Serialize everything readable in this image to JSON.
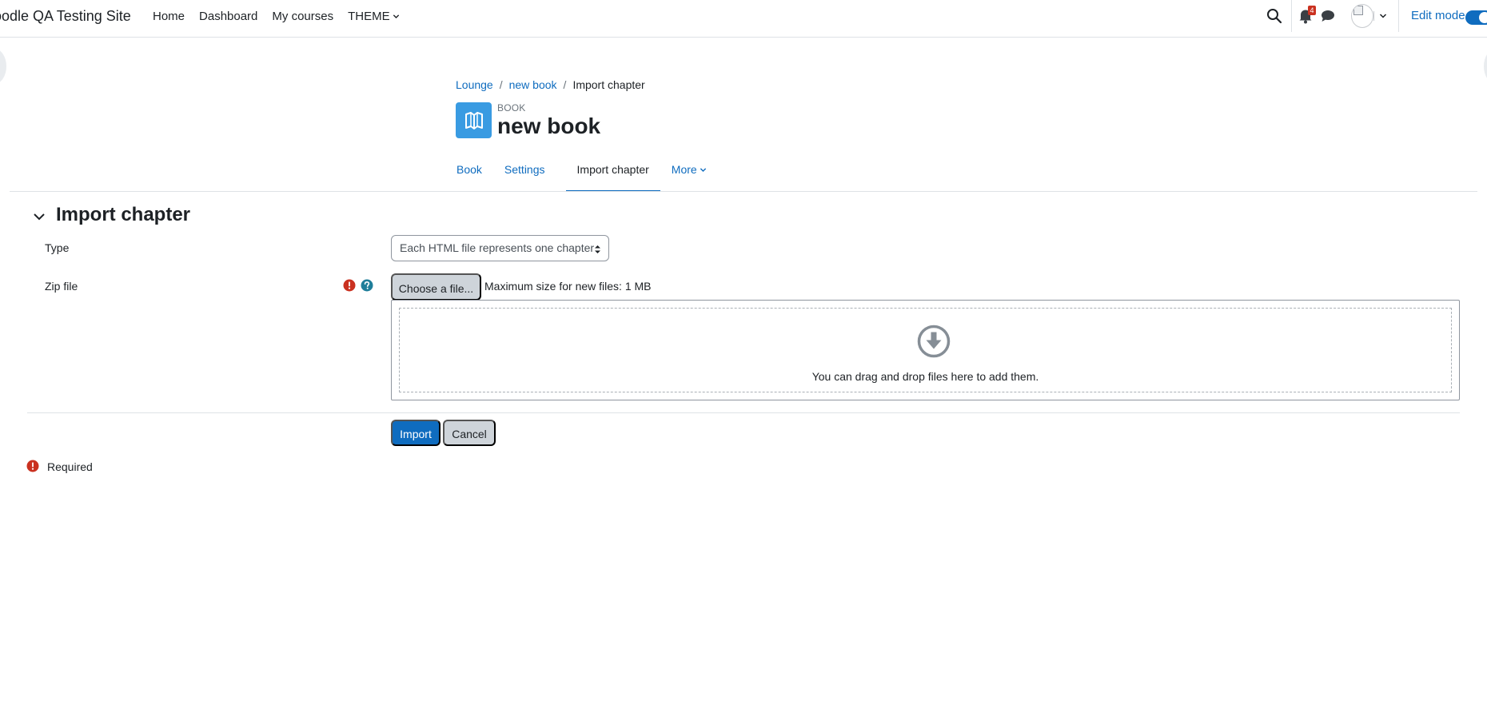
{
  "site": {
    "name": "oodle QA Testing Site"
  },
  "primary_nav": [
    {
      "label": "Home"
    },
    {
      "label": "Dashboard"
    },
    {
      "label": "My courses"
    },
    {
      "label": "THEME"
    }
  ],
  "user_menu": {
    "notification_count": "4",
    "edit_mode_label": "Edit mode",
    "edit_mode_on": true
  },
  "breadcrumb": [
    {
      "label": "Lounge"
    },
    {
      "label": "new book"
    },
    {
      "label": "Import chapter"
    }
  ],
  "header": {
    "activity_type": "BOOK",
    "title": "new book"
  },
  "secondary_nav": [
    {
      "label": "Book"
    },
    {
      "label": "Settings"
    },
    {
      "label": "Import chapter",
      "active": true
    },
    {
      "label": "More"
    }
  ],
  "form": {
    "section_title": "Import chapter",
    "type_label": "Type",
    "type_value": "Each HTML file represents one chapter",
    "zip_label": "Zip file",
    "choose_file_label": "Choose a file...",
    "max_size_text": "Maximum size for new files: 1 MB",
    "drop_text": "You can drag and drop files here to add them.",
    "import_label": "Import",
    "cancel_label": "Cancel",
    "required_text": "Required"
  },
  "colors": {
    "brand": "#0f6cbf",
    "activity_icon_bg": "#399be2",
    "danger": "#ca3120",
    "info": "#1f7e9a"
  },
  "icons": [
    "search-icon",
    "bell-icon",
    "chat-icon",
    "chevron-down-icon",
    "book-icon",
    "required-icon",
    "help-icon",
    "download-arrow-icon"
  ]
}
